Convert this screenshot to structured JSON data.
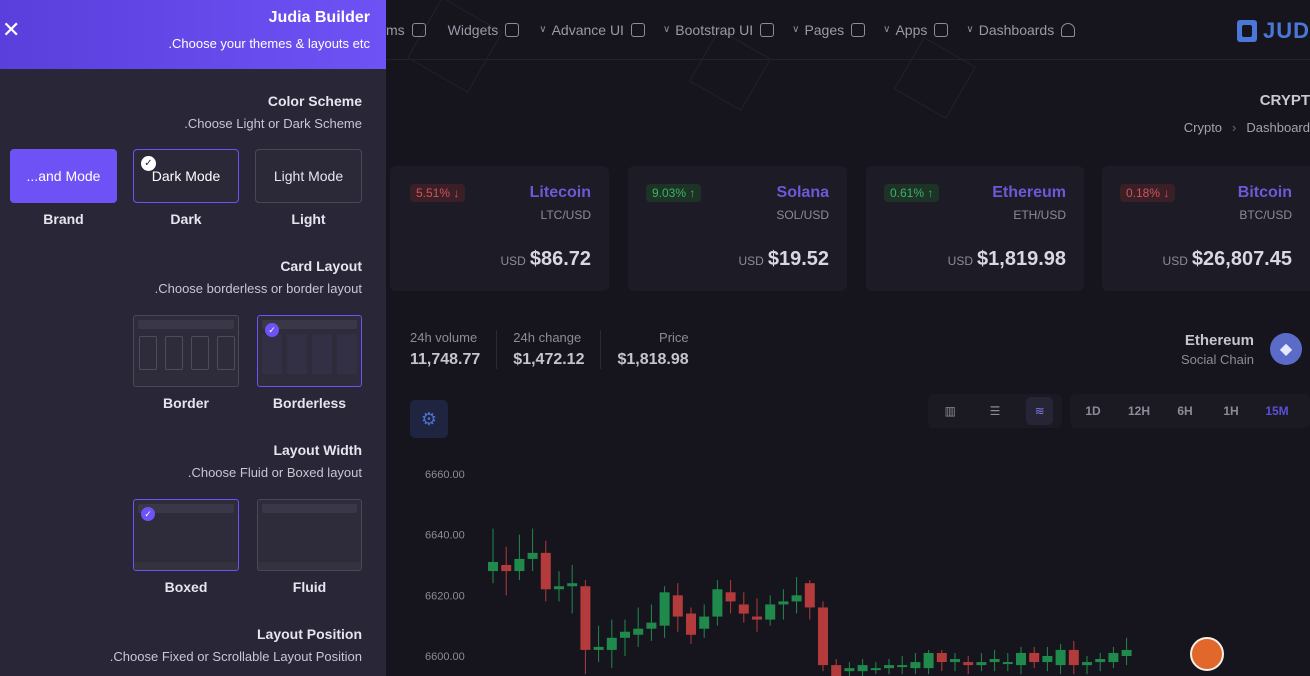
{
  "drawer": {
    "title": "Judia Builder",
    "subtitle": ".Choose your themes & layouts etc",
    "close_icon": "close-icon",
    "color_scheme": {
      "title": "Color Scheme",
      "subtitle": ".Choose Light or Dark Scheme",
      "options": [
        {
          "button": "...and Mode",
          "label": "Brand"
        },
        {
          "button": "Dark Mode",
          "label": "Dark"
        },
        {
          "button": "Light Mode",
          "label": "Light"
        }
      ]
    },
    "card_layout": {
      "title": "Card Layout",
      "subtitle": ".Choose borderless or border layout",
      "options": [
        {
          "label": "Border"
        },
        {
          "label": "Borderless"
        }
      ]
    },
    "layout_width": {
      "title": "Layout Width",
      "subtitle": ".Choose Fluid or Boxed layout",
      "options": [
        {
          "label": "Boxed"
        },
        {
          "label": "Fluid"
        }
      ]
    },
    "layout_position": {
      "title": "Layout Position",
      "subtitle": ".Choose Fixed or Scrollable Layout Position"
    },
    "accent": "#6e52f5"
  },
  "topnav": {
    "items": [
      {
        "label": "ms",
        "chevron": false
      },
      {
        "label": "Widgets",
        "chevron": false
      },
      {
        "label": "Advance UI",
        "chevron": true
      },
      {
        "label": "Bootstrap UI",
        "chevron": true
      },
      {
        "label": "Pages",
        "chevron": true
      },
      {
        "label": "Apps",
        "chevron": true
      },
      {
        "label": "Dashboards",
        "chevron": true
      }
    ],
    "logo_text": "JUD"
  },
  "page": {
    "title": "CRYPT",
    "breadcrumb": [
      "Crypto",
      "Dashboard"
    ]
  },
  "tickers": [
    {
      "change": "5.51% ↓",
      "dir": "down",
      "name": "Litecoin",
      "pair": "LTC/USD",
      "currency": "USD",
      "price": "$86.72"
    },
    {
      "change": "9.03% ↑",
      "dir": "up",
      "name": "Solana",
      "pair": "SOL/USD",
      "currency": "USD",
      "price": "$19.52"
    },
    {
      "change": "0.61% ↑",
      "dir": "up",
      "name": "Ethereum",
      "pair": "ETH/USD",
      "currency": "USD",
      "price": "$1,819.98"
    },
    {
      "change": "0.18% ↓",
      "dir": "down",
      "name": "Bitcoin",
      "pair": "BTC/USD",
      "currency": "USD",
      "price": "$26,807.45"
    }
  ],
  "stats": [
    {
      "label": "24h volume",
      "value": "11,748.77"
    },
    {
      "label": "24h change",
      "value": "$1,472.12"
    },
    {
      "label": "Price",
      "value": "$1,818.98"
    }
  ],
  "coin": {
    "name": "Ethereum",
    "subtitle": "Social Chain"
  },
  "timeframes": [
    "1D",
    "12H",
    "6H",
    "1H",
    "15M"
  ],
  "active_timeframe": "15M",
  "chart_data": {
    "type": "candlestick",
    "y_ticks": [
      "6660.00",
      "6640.00",
      "6620.00",
      "6600.00"
    ],
    "ylim": [
      6593,
      6665
    ],
    "candles": [
      {
        "o": 6628,
        "c": 6631,
        "h": 6642,
        "l": 6624
      },
      {
        "o": 6630,
        "c": 6628,
        "h": 6636,
        "l": 6620
      },
      {
        "o": 6628,
        "c": 6632,
        "h": 6640,
        "l": 6625
      },
      {
        "o": 6632,
        "c": 6634,
        "h": 6642,
        "l": 6628
      },
      {
        "o": 6634,
        "c": 6622,
        "h": 6638,
        "l": 6618
      },
      {
        "o": 6622,
        "c": 6623,
        "h": 6628,
        "l": 6618
      },
      {
        "o": 6623,
        "c": 6624,
        "h": 6630,
        "l": 6614
      },
      {
        "o": 6623,
        "c": 6602,
        "h": 6625,
        "l": 6594
      },
      {
        "o": 6602,
        "c": 6603,
        "h": 6610,
        "l": 6598
      },
      {
        "o": 6602,
        "c": 6606,
        "h": 6612,
        "l": 6596
      },
      {
        "o": 6606,
        "c": 6608,
        "h": 6612,
        "l": 6600
      },
      {
        "o": 6607,
        "c": 6609,
        "h": 6616,
        "l": 6603
      },
      {
        "o": 6609,
        "c": 6611,
        "h": 6617,
        "l": 6605
      },
      {
        "o": 6610,
        "c": 6621,
        "h": 6623,
        "l": 6606
      },
      {
        "o": 6620,
        "c": 6613,
        "h": 6624,
        "l": 6608
      },
      {
        "o": 6614,
        "c": 6607,
        "h": 6616,
        "l": 6604
      },
      {
        "o": 6609,
        "c": 6613,
        "h": 6617,
        "l": 6606
      },
      {
        "o": 6613,
        "c": 6622,
        "h": 6625,
        "l": 6610
      },
      {
        "o": 6621,
        "c": 6618,
        "h": 6625,
        "l": 6614
      },
      {
        "o": 6617,
        "c": 6614,
        "h": 6621,
        "l": 6611
      },
      {
        "o": 6613,
        "c": 6612,
        "h": 6619,
        "l": 6608
      },
      {
        "o": 6612,
        "c": 6617,
        "h": 6620,
        "l": 6610
      },
      {
        "o": 6617,
        "c": 6618,
        "h": 6622,
        "l": 6612
      },
      {
        "o": 6618,
        "c": 6620,
        "h": 6626,
        "l": 6614
      },
      {
        "o": 6624,
        "c": 6616,
        "h": 6625,
        "l": 6612
      },
      {
        "o": 6616,
        "c": 6597,
        "h": 6618,
        "l": 6595
      },
      {
        "o": 6597,
        "c": 6593,
        "h": 6599,
        "l": 6593
      },
      {
        "o": 6595,
        "c": 6596,
        "h": 6598,
        "l": 6593
      },
      {
        "o": 6595,
        "c": 6597,
        "h": 6599,
        "l": 6593
      },
      {
        "o": 6596,
        "c": 6596,
        "h": 6598,
        "l": 6594
      },
      {
        "o": 6596,
        "c": 6597,
        "h": 6599,
        "l": 6594
      },
      {
        "o": 6597,
        "c": 6597,
        "h": 6600,
        "l": 6594
      },
      {
        "o": 6596,
        "c": 6598,
        "h": 6601,
        "l": 6594
      },
      {
        "o": 6596,
        "c": 6601,
        "h": 6602,
        "l": 6594
      },
      {
        "o": 6601,
        "c": 6598,
        "h": 6602,
        "l": 6595
      },
      {
        "o": 6598,
        "c": 6599,
        "h": 6601,
        "l": 6595
      },
      {
        "o": 6598,
        "c": 6597,
        "h": 6600,
        "l": 6594
      },
      {
        "o": 6597,
        "c": 6598,
        "h": 6601,
        "l": 6595
      },
      {
        "o": 6598,
        "c": 6599,
        "h": 6602,
        "l": 6595
      },
      {
        "o": 6598,
        "c": 6598,
        "h": 6601,
        "l": 6595
      },
      {
        "o": 6597,
        "c": 6601,
        "h": 6603,
        "l": 6594
      },
      {
        "o": 6601,
        "c": 6598,
        "h": 6603,
        "l": 6596
      },
      {
        "o": 6598,
        "c": 6600,
        "h": 6603,
        "l": 6595
      },
      {
        "o": 6597,
        "c": 6602,
        "h": 6604,
        "l": 6594
      },
      {
        "o": 6602,
        "c": 6597,
        "h": 6605,
        "l": 6594
      },
      {
        "o": 6597,
        "c": 6598,
        "h": 6600,
        "l": 6594
      },
      {
        "o": 6598,
        "c": 6599,
        "h": 6601,
        "l": 6595
      },
      {
        "o": 6598,
        "c": 6601,
        "h": 6603,
        "l": 6596
      },
      {
        "o": 6600,
        "c": 6602,
        "h": 6606,
        "l": 6597
      }
    ]
  }
}
